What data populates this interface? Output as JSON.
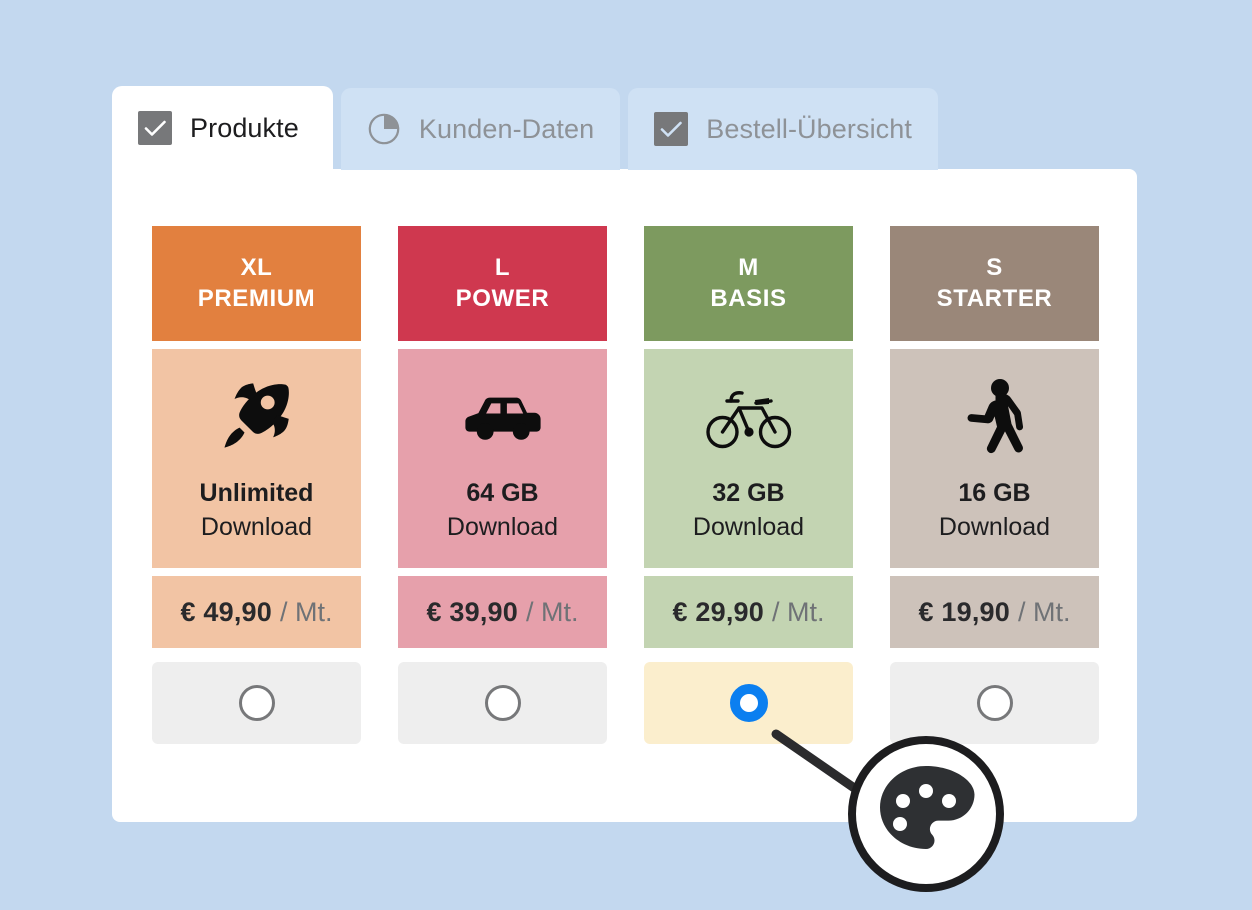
{
  "background_color": "#c3d8ef",
  "card": {
    "background": "#ffffff"
  },
  "tabs": [
    {
      "label": "Produkte",
      "icon": "checkbox-checked-icon",
      "active": true
    },
    {
      "label": "Kunden-Daten",
      "icon": "pie-chart-icon",
      "active": false
    },
    {
      "label": "Bestell-Übersicht",
      "icon": "checkbox-checked-icon",
      "active": false
    }
  ],
  "plans": [
    {
      "size": "XL",
      "name": "PREMIUM",
      "header_color": "#e2803f",
      "body_color": "#f2c4a4",
      "price_color": "#f2c4a4",
      "icon": "rocket-icon",
      "amount": "Unlimited",
      "sub": "Download",
      "price": "€ 49,90",
      "price_unit": "/ Mt.",
      "selected": false
    },
    {
      "size": "L",
      "name": "POWER",
      "header_color": "#cf384f",
      "body_color": "#e6a0ab",
      "price_color": "#e6a0ab",
      "icon": "car-icon",
      "amount": "64 GB",
      "sub": "Download",
      "price": "€ 39,90",
      "price_unit": "/ Mt.",
      "selected": false
    },
    {
      "size": "M",
      "name": "BASIS",
      "header_color": "#7d9a5f",
      "body_color": "#c3d4b2",
      "price_color": "#c3d4b2",
      "icon": "bicycle-icon",
      "amount": "32 GB",
      "sub": "Download",
      "price": "€ 29,90",
      "price_unit": "/ Mt.",
      "selected": true
    },
    {
      "size": "S",
      "name": "STARTER",
      "header_color": "#9a8779",
      "body_color": "#cdc2ba",
      "price_color": "#cdc2ba",
      "icon": "walking-person-icon",
      "amount": "16 GB",
      "sub": "Download",
      "price": "€ 19,90",
      "price_unit": "/ Mt.",
      "selected": false
    }
  ],
  "selection": {
    "selected_index": 2,
    "selected_color": "#0b7ff0",
    "selected_row_bg": "#fbeecd",
    "unselected_row_bg": "#eeeeee"
  },
  "cursor_badge": {
    "icon": "palette-icon",
    "fill": "#2e3033",
    "ring": "#1d1d1f"
  }
}
